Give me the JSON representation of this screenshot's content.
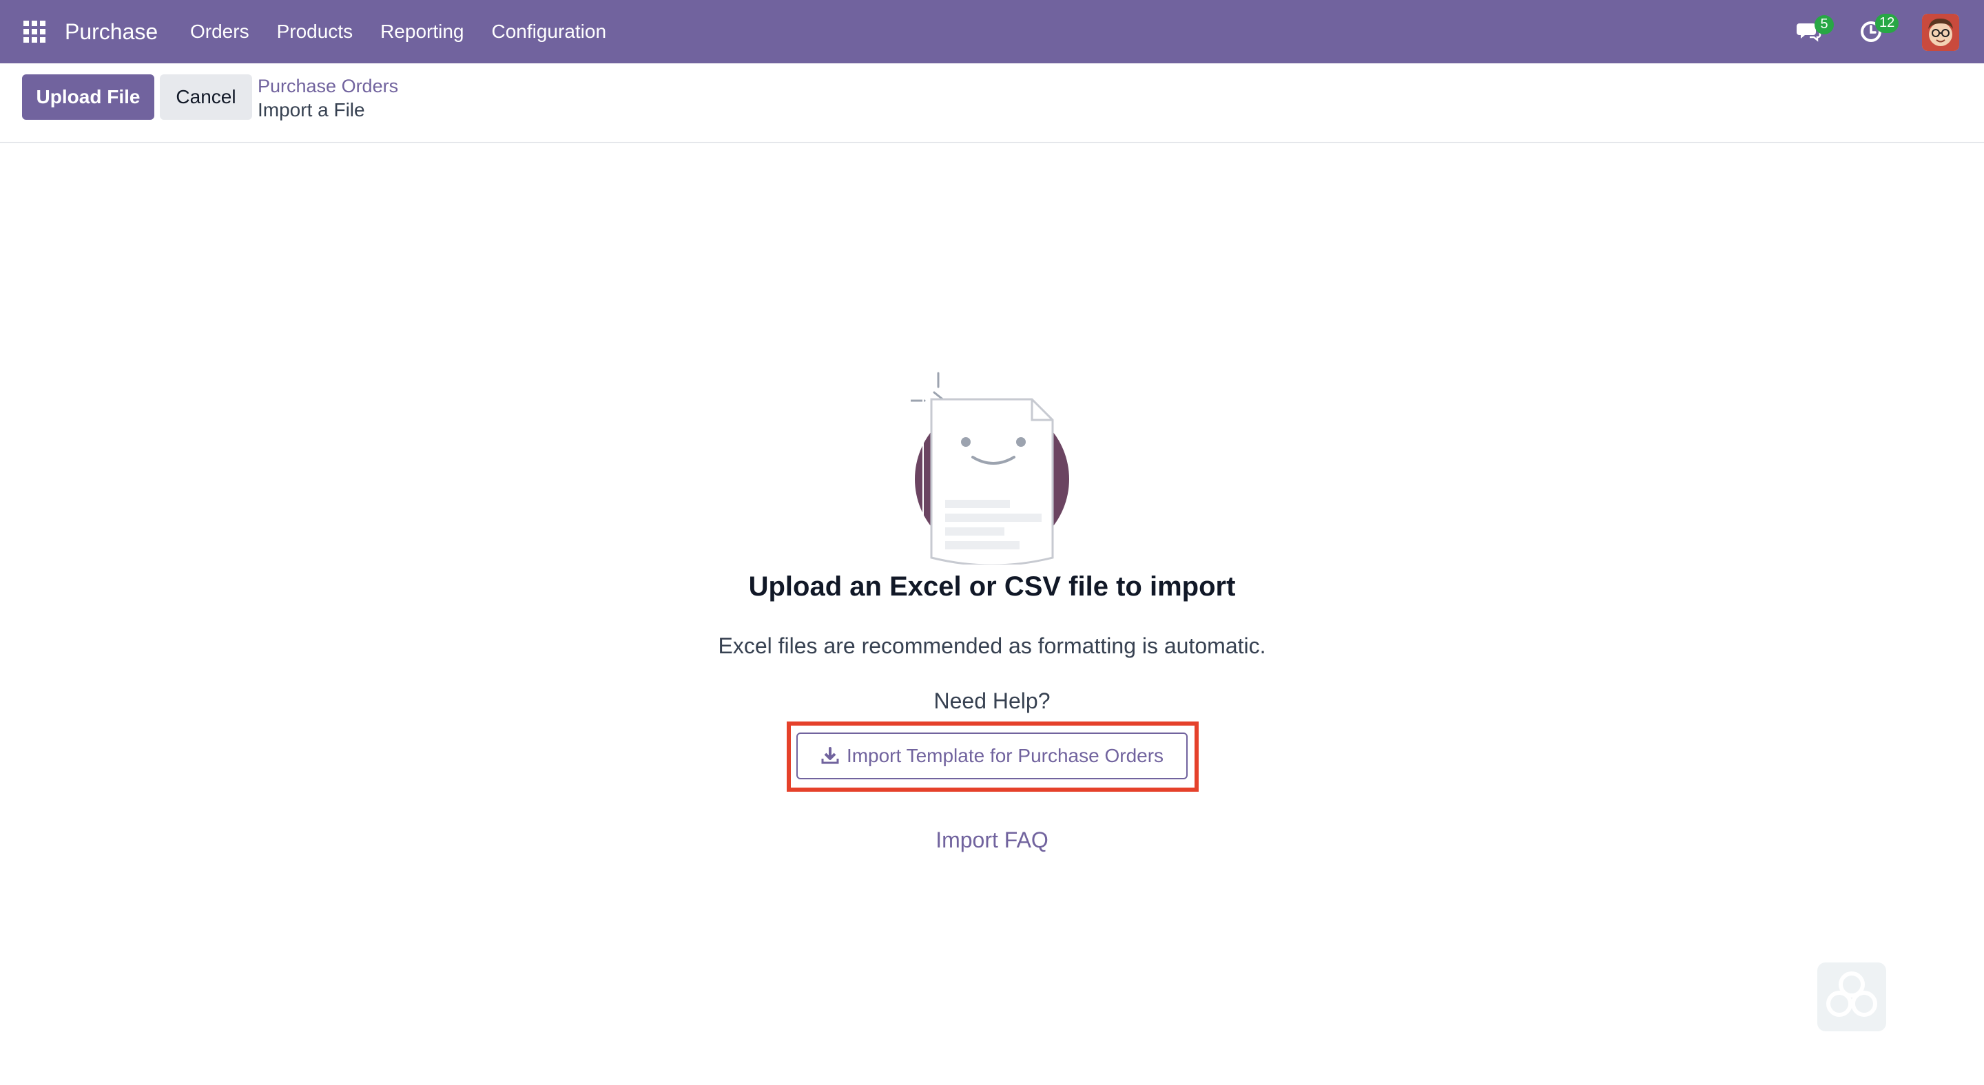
{
  "navbar": {
    "brand": "Purchase",
    "menu": [
      {
        "label": "Orders"
      },
      {
        "label": "Products"
      },
      {
        "label": "Reporting"
      },
      {
        "label": "Configuration"
      }
    ],
    "messages_count": "5",
    "activities_count": "12",
    "accent_color": "#71639e"
  },
  "control_panel": {
    "upload_label": "Upload File",
    "cancel_label": "Cancel",
    "breadcrumb_parent": "Purchase Orders",
    "breadcrumb_current": "Import a File"
  },
  "main": {
    "title": "Upload an Excel or CSV file to import",
    "subtitle": "Excel files are recommended as formatting is automatic.",
    "help_label": "Need Help?",
    "template_button_label": "Import Template for Purchase Orders",
    "faq_label": "Import FAQ",
    "highlight_color": "#e5412b"
  },
  "icons": {
    "apps": "apps-grid-icon",
    "messages": "chat-bubble-icon",
    "activities": "clock-icon",
    "download": "download-icon"
  }
}
